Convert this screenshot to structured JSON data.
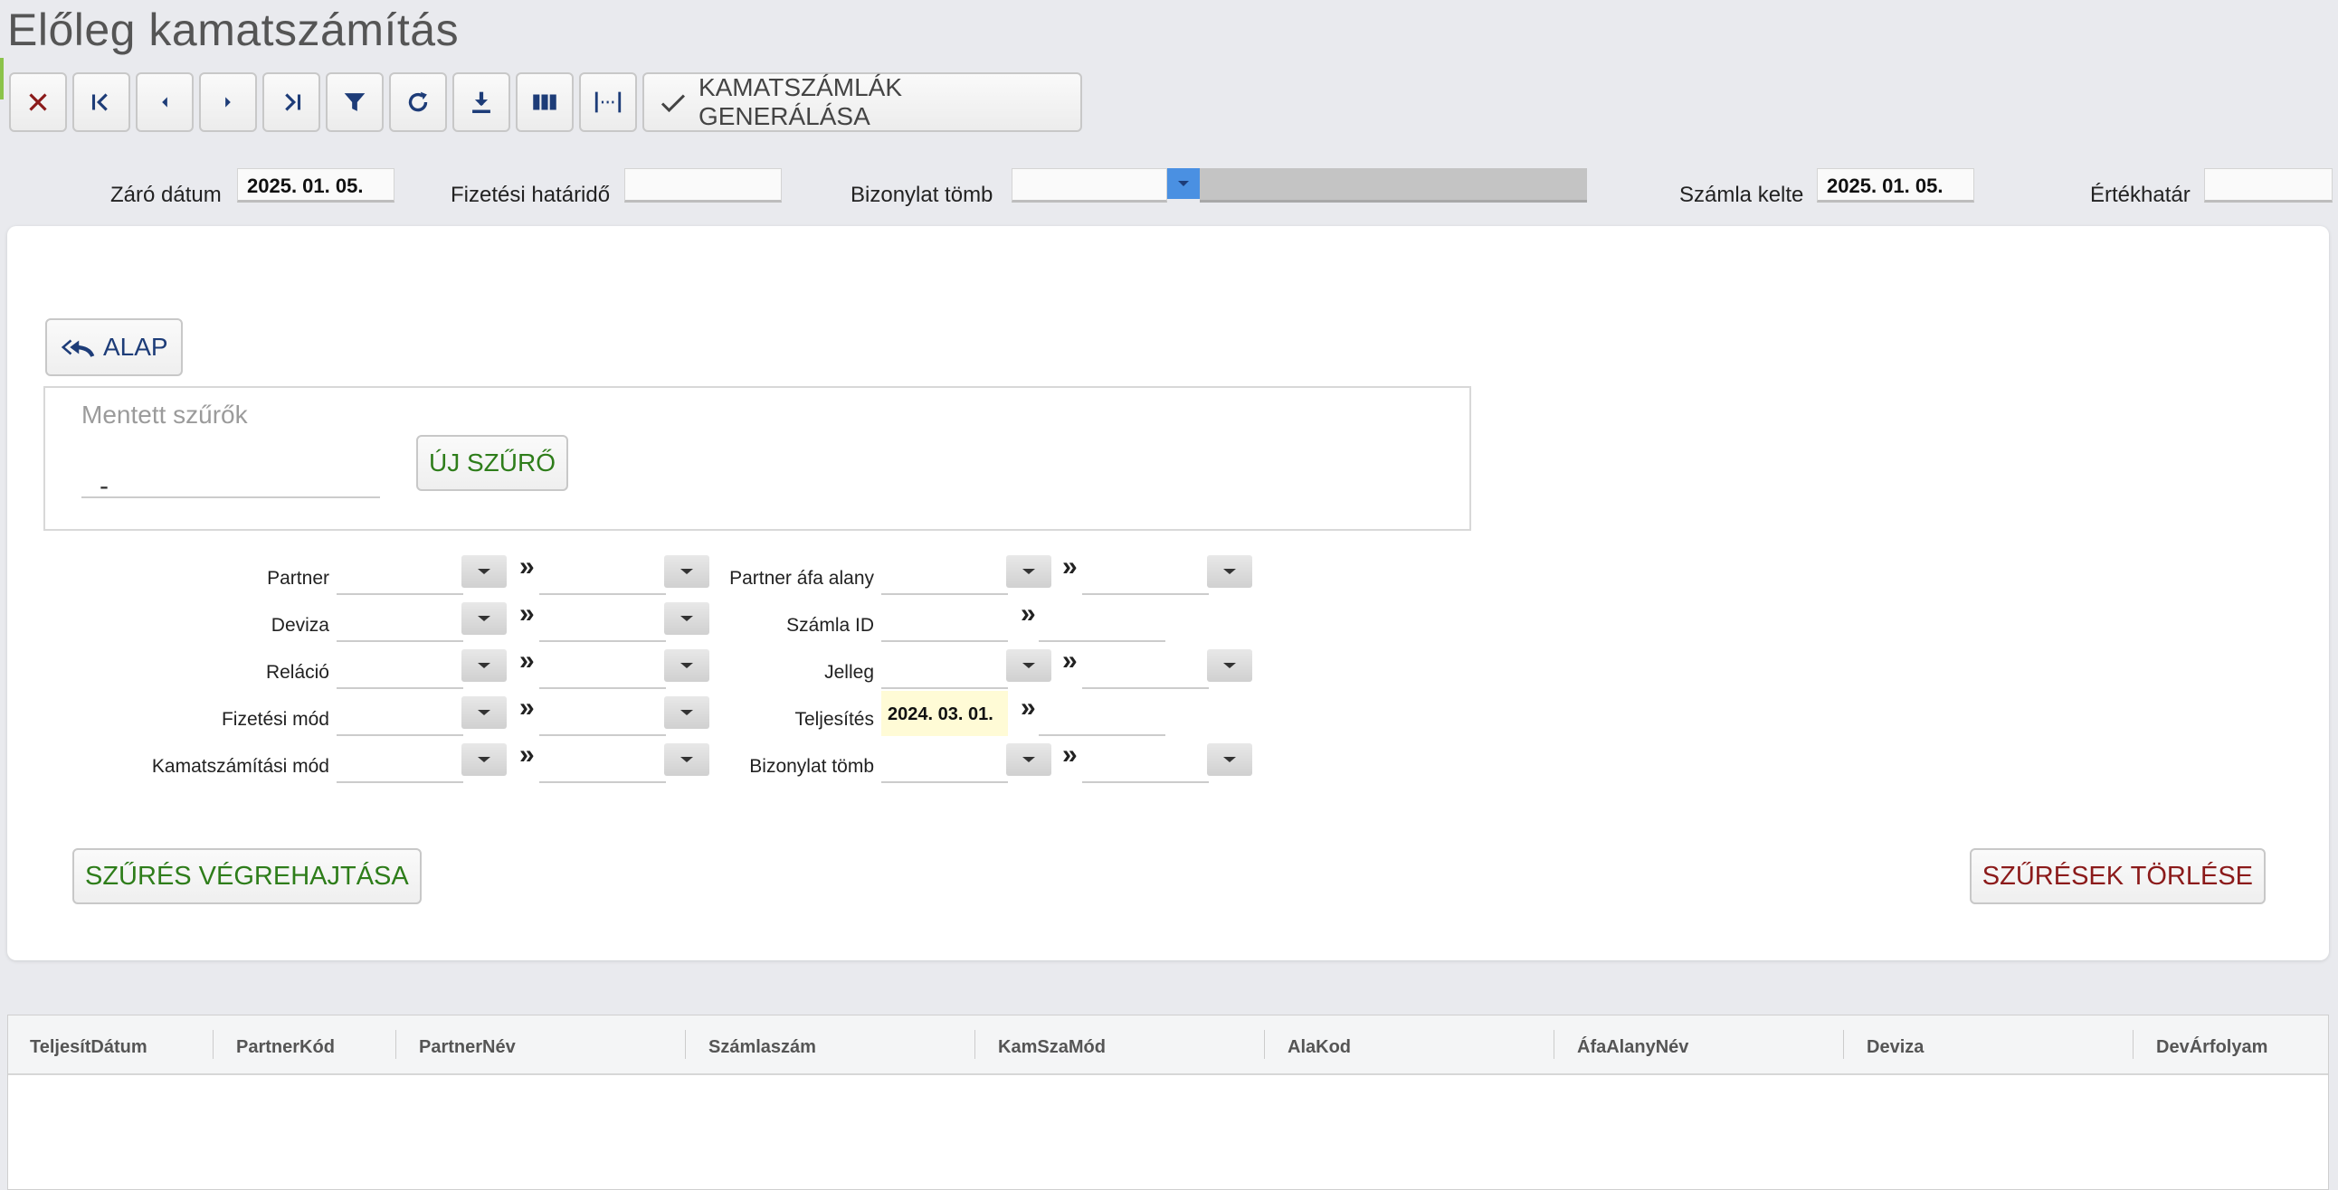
{
  "page": {
    "title": "Előleg kamatszámítás"
  },
  "toolbar": {
    "buttons": [
      {
        "icon": "close-icon"
      },
      {
        "icon": "first-page-icon"
      },
      {
        "icon": "prev-icon"
      },
      {
        "icon": "next-icon"
      },
      {
        "icon": "last-page-icon"
      },
      {
        "icon": "filter-icon"
      },
      {
        "icon": "refresh-icon"
      },
      {
        "icon": "download-icon"
      },
      {
        "icon": "columns-icon"
      },
      {
        "icon": "fit-width-icon"
      }
    ],
    "generate_label": "KAMATSZÁMLÁK GENERÁLÁSA"
  },
  "header": {
    "closing_date_label": "Záró dátum",
    "closing_date_value": "2025. 01. 05.",
    "payment_deadline_label": "Fizetési határidő",
    "payment_deadline_value": "",
    "doc_block_label": "Bizonylat tömb",
    "invoice_date_label": "Számla kelte",
    "invoice_date_value": "2025. 01. 05.",
    "value_limit_label": "Értékhatár",
    "value_limit_value": ""
  },
  "filter": {
    "alap_label": "ALAP",
    "saved_filters_label": "Mentett szűrők",
    "saved_filters_value": "-",
    "new_filter_label": "ÚJ SZŰRŐ",
    "range_sep": "»",
    "left_rows": [
      "Partner",
      "Deviza",
      "Reláció",
      "Fizetési mód",
      "Kamatszámítási mód"
    ],
    "right_rows": [
      "Partner áfa alany",
      "Számla ID",
      "Jelleg",
      "Teljesítés",
      "Bizonylat tömb"
    ],
    "teljesites_from": "2024. 03. 01.",
    "execute_label": "SZŰRÉS VÉGREHAJTÁSA",
    "clear_label": "SZŰRÉSEK TÖRLÉSE"
  },
  "grid": {
    "columns": [
      "TeljesítDátum",
      "PartnerKód",
      "PartnerNév",
      "Számlaszám",
      "KamSzaMód",
      "AlaKod",
      "ÁfaAlanyNév",
      "Deviza",
      "DevÁrfolyam"
    ]
  },
  "colors": {
    "accent": "#1d3c78",
    "green": "#2e7d1a",
    "red": "#8b1a1a",
    "select_blue": "#4a90e2"
  }
}
